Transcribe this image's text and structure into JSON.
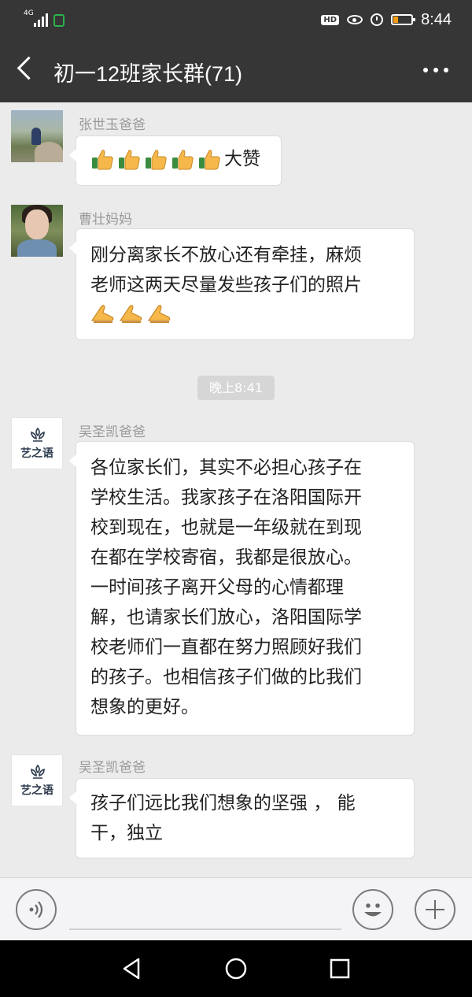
{
  "status_bar": {
    "network": "4G",
    "hd_badge": "HD",
    "time": "8:44",
    "icons": [
      "signal-icon",
      "lock-icon",
      "eye-icon",
      "alarm-icon",
      "battery-icon"
    ],
    "battery_color": "#f39c12"
  },
  "header": {
    "title": "初一12班家长群(71)",
    "back_icon": "back-arrow-icon",
    "more_icon": "more-dots-icon",
    "background": "#363636"
  },
  "messages": [
    {
      "sender": "张世玉爸爸",
      "emoji_count": 5,
      "emoji": "thumbs-up-icon",
      "text": "大赞"
    },
    {
      "sender": "曹壮妈妈",
      "lines": [
        "刚分离家长不放心还有牵挂，麻烦",
        "老师这两天尽量发些孩子们的照片"
      ],
      "emoji_count": 3,
      "emoji": "pray-hands-icon"
    },
    {
      "sender": "吴圣凯爸爸",
      "lines": [
        "各位家长们，其实不必担心孩子在",
        "学校生活。我家孩子在洛阳国际开",
        "校到现在，也就是一年级就在到现",
        "在都在学校寄宿，我都是很放心。",
        "一时间孩子离开父母的心情都理",
        "解，也请家长们放心，洛阳国际学",
        "校老师们一直都在努力照顾好我们",
        "的孩子。也相信孩子们做的比我们",
        "想象的更好。"
      ]
    },
    {
      "sender": "吴圣凯爸爸",
      "lines": [
        "孩子们远比我们想象的坚强 ， 能",
        "干，独立"
      ]
    }
  ],
  "timestamp": "晚上8:41",
  "avatar_logo_text": "艺之语",
  "input_bar": {
    "voice_icon": "voice-icon",
    "emoji_icon": "smiley-icon",
    "plus_icon": "plus-icon",
    "value": ""
  },
  "nav_bar": {
    "icons": [
      "nav-back-icon",
      "nav-home-icon",
      "nav-recents-icon"
    ]
  }
}
